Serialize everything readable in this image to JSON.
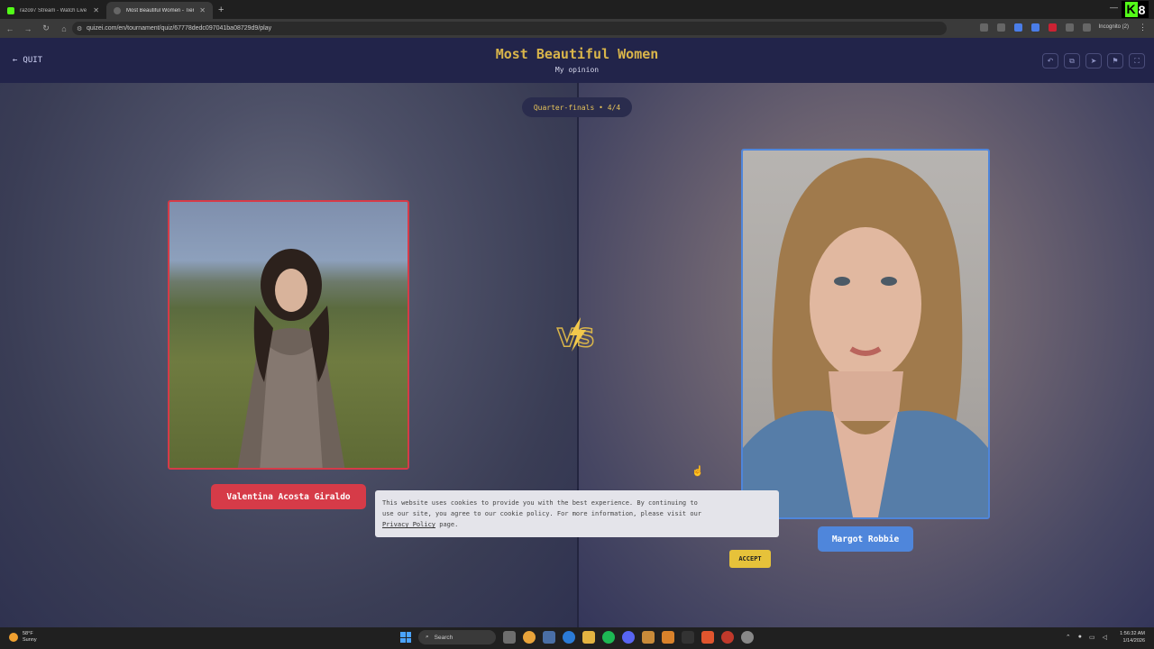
{
  "browser": {
    "tabs": [
      {
        "title": "razo97 Stream - Watch Live on",
        "close": "✕"
      },
      {
        "title": "Most Beautiful Women - Tier Li",
        "close": "✕"
      }
    ],
    "new_tab": "+",
    "url": "quizei.com/en/tournament/quiz/67778dedc097041ba08729d9/play",
    "incognito_label": "Incognito (2)",
    "kick_badge": {
      "k": "K",
      "n": "8"
    }
  },
  "header": {
    "quit_label": "QUIT",
    "title": "Most Beautiful Women",
    "subtitle": "My opinion",
    "icons": [
      "undo-icon",
      "share-icon",
      "send-icon",
      "flag-icon",
      "fullscreen-icon"
    ]
  },
  "round": {
    "label": "Quarter-finals • 4/4"
  },
  "contestants": [
    {
      "name": "Valentina Acosta Giraldo",
      "color": "#d63b48"
    },
    {
      "name": "Margot Robbie",
      "color": "#4f86db"
    }
  ],
  "cookie": {
    "text_before": "This website uses cookies to provide you with the best experience. By continuing to use our site, you agree to our cookie policy. For more information, please visit our ",
    "link": "Privacy Policy",
    "text_after": " page.",
    "accept_label": "ACCEPT"
  },
  "taskbar": {
    "temp": "58°F",
    "weather": "Sunny",
    "search_placeholder": "Search",
    "time": "1:56:32 AM",
    "date": "1/14/2026"
  },
  "colors": {
    "accent_gold": "#d9b54a",
    "left_red": "#d63b48",
    "right_blue": "#4f86db"
  }
}
